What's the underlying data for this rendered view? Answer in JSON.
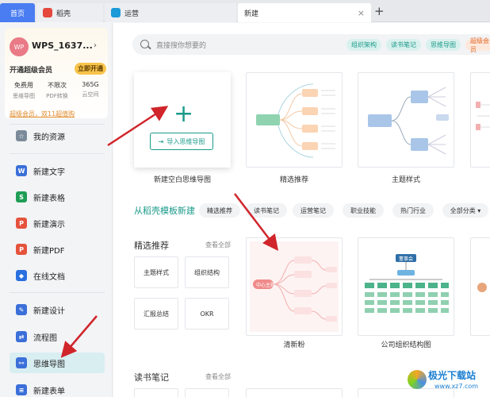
{
  "tabs": {
    "home": "首页",
    "daoke": "稻壳",
    "ops": "运营",
    "new": "新建",
    "close": "×",
    "add": "+"
  },
  "sidebar": {
    "avatar": "WP",
    "username": "WPS_1637...",
    "username_arrow": "›",
    "vip_text": "开通超级会员",
    "vip_button": "立即开通",
    "perks": [
      {
        "title": "免费用",
        "sub": "思维导图"
      },
      {
        "title": "不限次",
        "sub": "PDF转换"
      },
      {
        "title": "365G",
        "sub": "云空间"
      }
    ],
    "promo": "超级会员，双11超值购",
    "items": [
      {
        "label": "我的资源",
        "color": "#7b8a9a",
        "glyph": "☆"
      },
      {
        "label": "新建文字",
        "color": "#3b6fd9",
        "glyph": "W"
      },
      {
        "label": "新建表格",
        "color": "#1f9d55",
        "glyph": "S"
      },
      {
        "label": "新建演示",
        "color": "#e5533d",
        "glyph": "P"
      },
      {
        "label": "新建PDF",
        "color": "#e5533d",
        "glyph": "P"
      },
      {
        "label": "在线文档",
        "color": "#2a6fe0",
        "glyph": "◆"
      },
      {
        "label": "新建设计",
        "color": "#3b6fd9",
        "glyph": "✎"
      },
      {
        "label": "流程图",
        "color": "#3b6fd9",
        "glyph": "⇄"
      },
      {
        "label": "思维导图",
        "color": "#3b6fd9",
        "glyph": "⚯"
      },
      {
        "label": "新建表单",
        "color": "#3b6fd9",
        "glyph": "≡"
      }
    ]
  },
  "main": {
    "search_placeholder": "直接搜你想要的",
    "chips": [
      "组织架构",
      "读书笔记",
      "思维导图",
      "超级会员"
    ],
    "blank_card": {
      "import": "导入思维导图",
      "label": "新建空白思维导图"
    },
    "top_templates": [
      "精选推荐",
      "主题样式"
    ],
    "section_title": "从稻壳模板新建",
    "pills": [
      "精选推荐",
      "读书笔记",
      "运营笔记",
      "职业技能",
      "热门行业",
      "全部分类 ▾"
    ],
    "featured": {
      "title": "精选推荐",
      "view_all": "查看全部",
      "items": [
        "主题样式",
        "组织结构",
        "汇报总结",
        "OKR"
      ]
    },
    "featured_templates": [
      "清新粉",
      "公司组织结构图"
    ],
    "reading": {
      "title": "读书笔记",
      "view_all": "查看全部"
    },
    "mindmap_center": "中心主题",
    "org_top": "董事会"
  },
  "watermark": {
    "name": "极光下载站",
    "url": "www.xz7.com"
  }
}
